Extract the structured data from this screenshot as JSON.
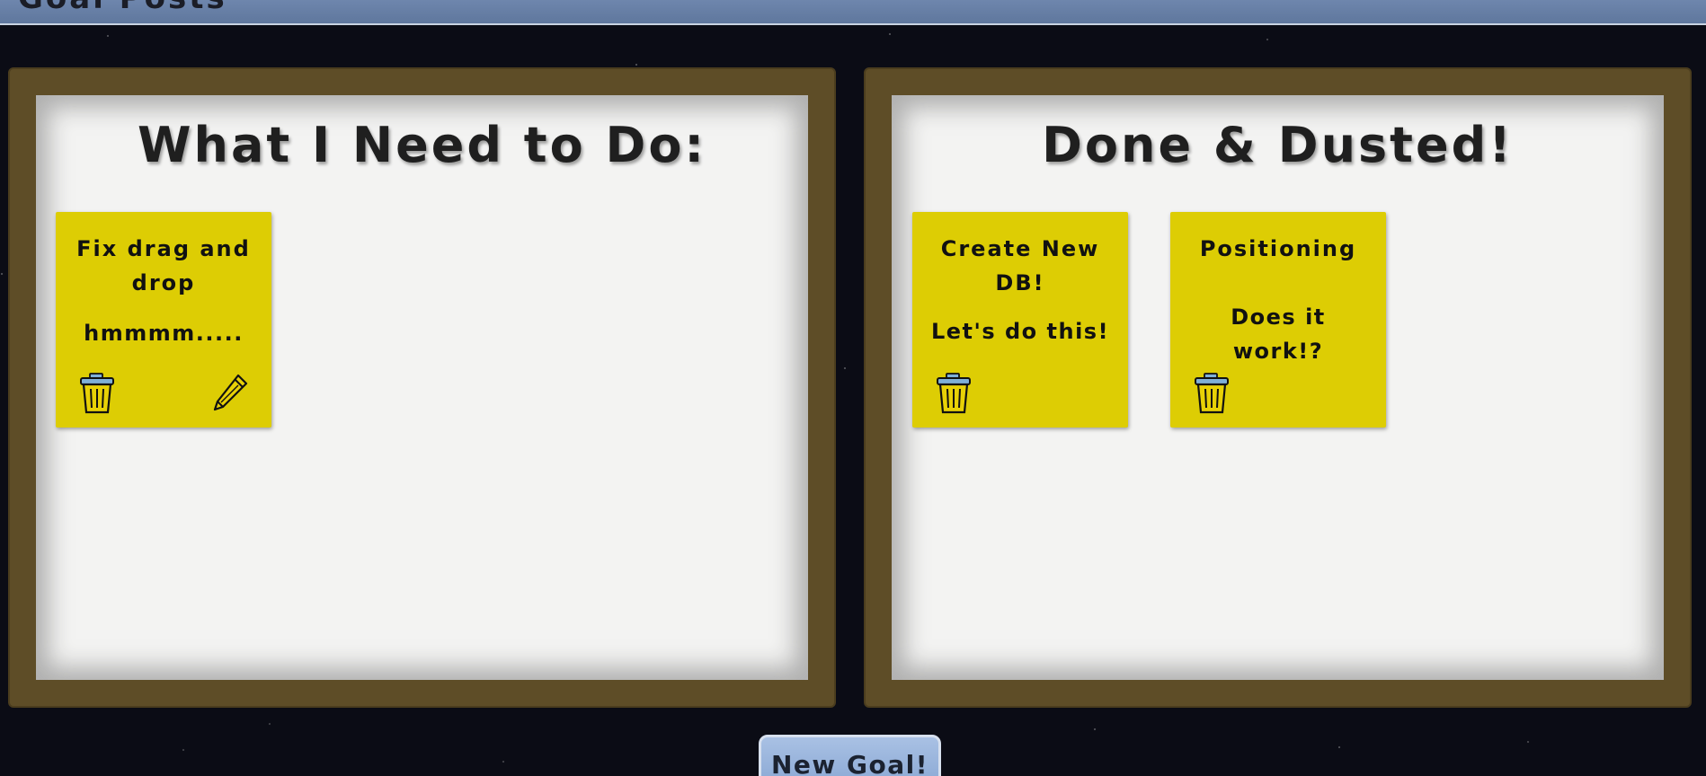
{
  "header": {
    "title": "Goal Posts"
  },
  "boards": [
    {
      "title": "What I Need to Do:",
      "notes": [
        {
          "title": "Fix drag and drop",
          "body": "hmmmm....."
        }
      ]
    },
    {
      "title": "Done & Dusted!",
      "notes": [
        {
          "title": "Create New DB!",
          "body": "Let's do this!"
        },
        {
          "title": "Positioning",
          "body": "Does it work!?"
        }
      ]
    }
  ],
  "actions": {
    "new_goal_label": "New Goal!"
  },
  "colors": {
    "background": "#0b0c15",
    "board_frame": "#5e4d27",
    "board_surface": "#f3f3f2",
    "note": "#ddcd04",
    "button": "#8aa8d4"
  },
  "icons": {
    "delete": "trash-icon",
    "edit": "pencil-icon"
  }
}
